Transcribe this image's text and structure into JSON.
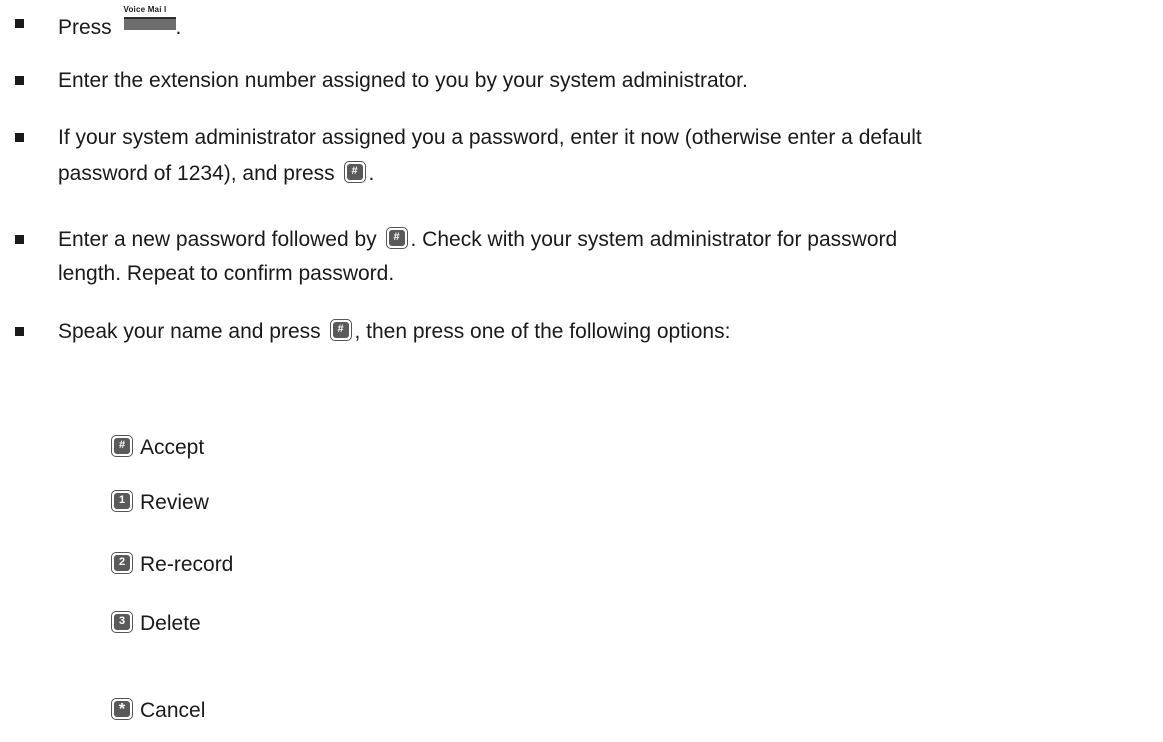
{
  "steps": [
    {
      "pre": "Press ",
      "button_label": "Voice Mai  l",
      "post": "."
    },
    {
      "text": "Enter the extension number assigned to you by your system administrator."
    },
    {
      "line1": "If your system administrator assigned you a password, enter it now (otherwise enter a default",
      "line2_pre": "password of 1234), and press ",
      "key": "#",
      "line2_post": "."
    },
    {
      "pre": "Enter a new password followed by ",
      "key": "#",
      "post": ". Check with your system administrator for password",
      "line2": "length. Repeat to confirm password."
    },
    {
      "pre": "Speak your name and press ",
      "key": "#",
      "post": ", then press one of the following options:"
    }
  ],
  "options": [
    {
      "key": "#",
      "label": "Accept"
    },
    {
      "key": "1",
      "label": "Review"
    },
    {
      "key": "2",
      "label": "Re-record"
    },
    {
      "key": "3",
      "label": "Delete"
    },
    {
      "key": "*",
      "label": "Cancel"
    }
  ]
}
